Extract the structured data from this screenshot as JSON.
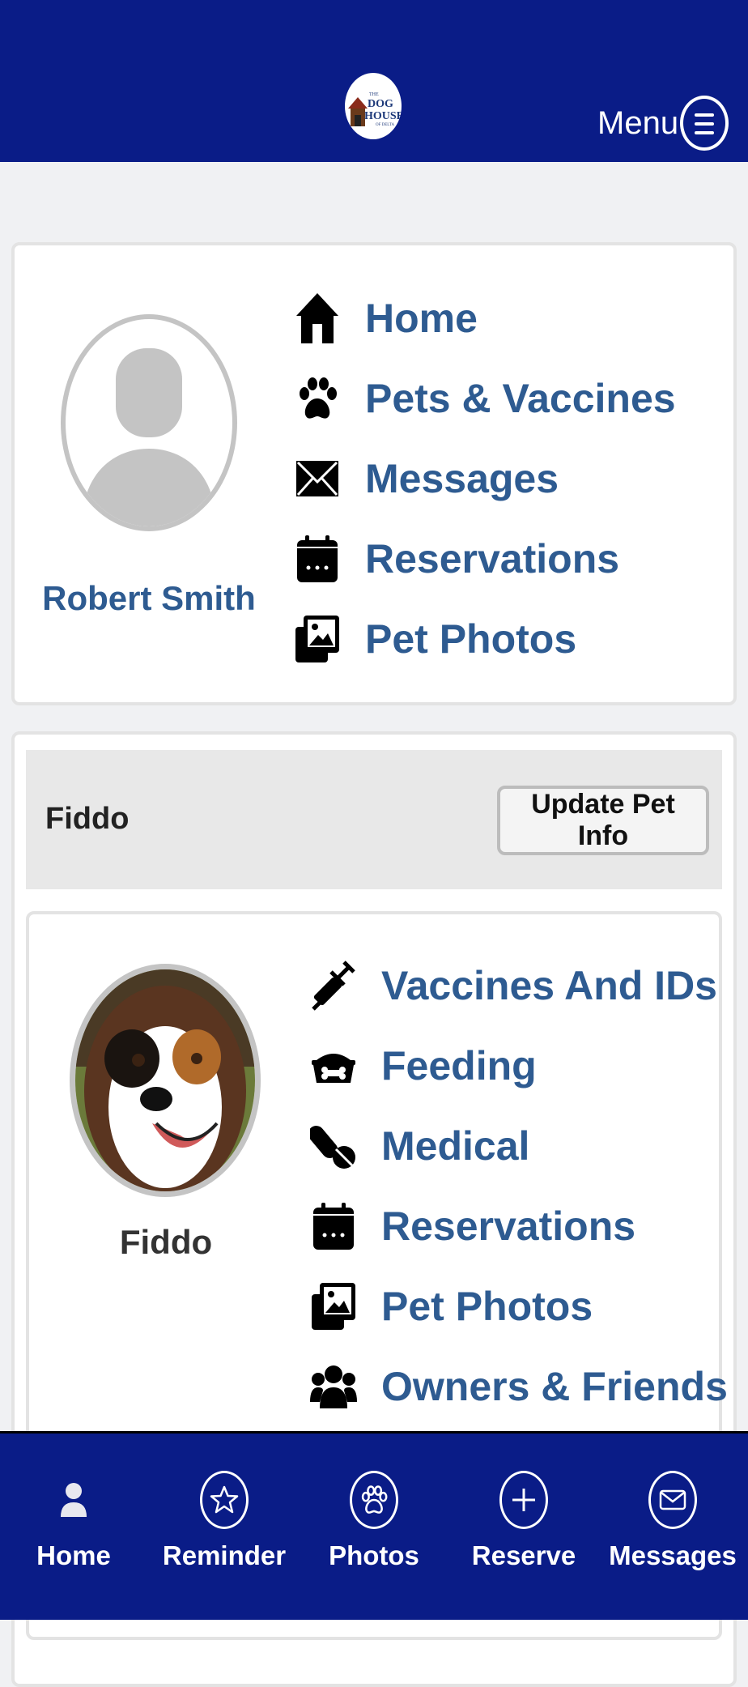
{
  "header": {
    "logo_text": {
      "line1": "THE",
      "line2": "DOG",
      "line3": "HOUSE",
      "line4": "OF DELTA"
    },
    "menu_label": "Menu"
  },
  "user": {
    "name": "Robert Smith"
  },
  "main_nav": [
    {
      "label": "Home",
      "icon": "home-icon"
    },
    {
      "label": "Pets & Vaccines",
      "icon": "paw-icon"
    },
    {
      "label": "Messages",
      "icon": "envelope-icon"
    },
    {
      "label": "Reservations",
      "icon": "calendar-icon"
    },
    {
      "label": "Pet Photos",
      "icon": "photos-icon"
    }
  ],
  "pet": {
    "header_name": "Fiddo",
    "update_button": "Update Pet Info",
    "name": "Fiddo",
    "menu": [
      {
        "label": "Vaccines And IDs",
        "icon": "syringe-icon"
      },
      {
        "label": "Feeding",
        "icon": "food-bowl-icon"
      },
      {
        "label": "Medical",
        "icon": "pills-icon"
      },
      {
        "label": "Reservations",
        "icon": "calendar-icon"
      },
      {
        "label": "Pet Photos",
        "icon": "photos-icon"
      },
      {
        "label": "Owners & Friends",
        "icon": "users-icon"
      }
    ]
  },
  "tabbar": [
    {
      "label": "Home",
      "icon": "person-icon"
    },
    {
      "label": "Reminder",
      "icon": "star-icon"
    },
    {
      "label": "Photos",
      "icon": "paw-icon"
    },
    {
      "label": "Reserve",
      "icon": "plus-icon"
    },
    {
      "label": "Messages",
      "icon": "envelope-icon"
    }
  ],
  "colors": {
    "brand_navy": "#0a1c87",
    "link_blue": "#2e5b91",
    "page_bg": "#f0f1f3"
  }
}
